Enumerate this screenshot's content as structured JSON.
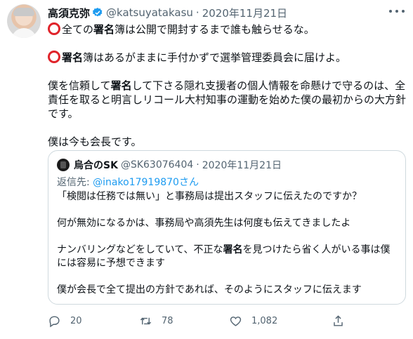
{
  "tweet": {
    "author_name": "高須克弥",
    "author_handle": "@katsuyatakasu",
    "separator": "·",
    "date": "2020年11月21日",
    "line1_pre": "全ての",
    "line1_bold": "署名",
    "line1_post": "簿は公開で開封するまで誰も触らせるな。",
    "line2_bold": "署名",
    "line2_post": "簿はあるがままに手付かずで選挙管理委員会に届けよ。",
    "line3_pre": "僕を信頼して",
    "line3_bold": "署名",
    "line3_post": "して下さる隠れ支援者の個人情報を命懸けで守るのは、全責任を取ると明言しリコール大村知事の運動を始めた僕の最初からの大方針です。",
    "line4": "僕は今も会長です。"
  },
  "quote": {
    "author_name": "烏合のSK",
    "author_handle": "@SK63076404",
    "separator": "·",
    "date": "2020年11月21日",
    "reply_label": "返信先: ",
    "reply_handle": "@inako17919870さん",
    "p1": "「検閲は任務では無い」と事務局は提出スタッフに伝えたのですか？",
    "p2": "何が無効になるかは、事務局や高須先生は何度も伝えてきましたよ",
    "p3_pre": "ナンバリングなどをしていて、不正な",
    "p3_bold": "署名",
    "p3_post": "を見つけたら省く人がいる事は僕には容易に予想できます",
    "p4": "僕が会長で全て提出の方針であれば、そのようにスタッフに伝えます"
  },
  "actions": {
    "reply_count": "20",
    "retweet_count": "78",
    "like_count": "1,082"
  },
  "colors": {
    "accent": "#1d9bf0",
    "muted": "#536471",
    "red_circle": "#e0242b"
  },
  "icons": [
    "verified-badge-icon",
    "more-icon",
    "reply-icon",
    "retweet-icon",
    "like-icon",
    "share-icon"
  ]
}
